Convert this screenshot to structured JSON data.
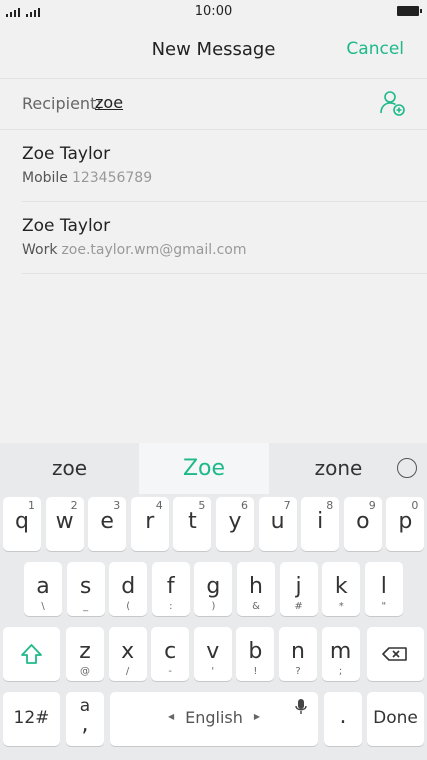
{
  "status": {
    "time": "10:00"
  },
  "header": {
    "title": "New Message",
    "cancel": "Cancel"
  },
  "recipient": {
    "label": "Recipient:",
    "value": "zoe"
  },
  "contacts": [
    {
      "name": "Zoe Taylor",
      "type": "Mobile",
      "detail": "123456789"
    },
    {
      "name": "Zoe Taylor",
      "type": "Work",
      "detail": "zoe.taylor.wm@gmail.com"
    }
  ],
  "suggestions": [
    "zoe",
    "Zoe",
    "zone"
  ],
  "keyboard": {
    "row1": [
      {
        "k": "q",
        "n": "1"
      },
      {
        "k": "w",
        "n": "2"
      },
      {
        "k": "e",
        "n": "3"
      },
      {
        "k": "r",
        "n": "4"
      },
      {
        "k": "t",
        "n": "5"
      },
      {
        "k": "y",
        "n": "6"
      },
      {
        "k": "u",
        "n": "7"
      },
      {
        "k": "i",
        "n": "8"
      },
      {
        "k": "o",
        "n": "9"
      },
      {
        "k": "p",
        "n": "0"
      }
    ],
    "row2": [
      {
        "k": "a",
        "s": "\\"
      },
      {
        "k": "s",
        "s": "_"
      },
      {
        "k": "d",
        "s": "("
      },
      {
        "k": "f",
        "s": ":"
      },
      {
        "k": "g",
        "s": ")"
      },
      {
        "k": "h",
        "s": "&"
      },
      {
        "k": "j",
        "s": "#"
      },
      {
        "k": "k",
        "s": "*"
      },
      {
        "k": "l",
        "s": "\""
      }
    ],
    "row3": [
      {
        "k": "z",
        "s": "@"
      },
      {
        "k": "x",
        "s": "/"
      },
      {
        "k": "c",
        "s": "-"
      },
      {
        "k": "v",
        "s": "'"
      },
      {
        "k": "b",
        "s": "!"
      },
      {
        "k": "n",
        "s": "?"
      },
      {
        "k": "m",
        "s": ";"
      }
    ],
    "sym_label": "12#",
    "lang_top": "a",
    "lang_bottom": ",",
    "space_label": "English",
    "period": ".",
    "done": "Done"
  },
  "colors": {
    "accent": "#1eb98a"
  }
}
